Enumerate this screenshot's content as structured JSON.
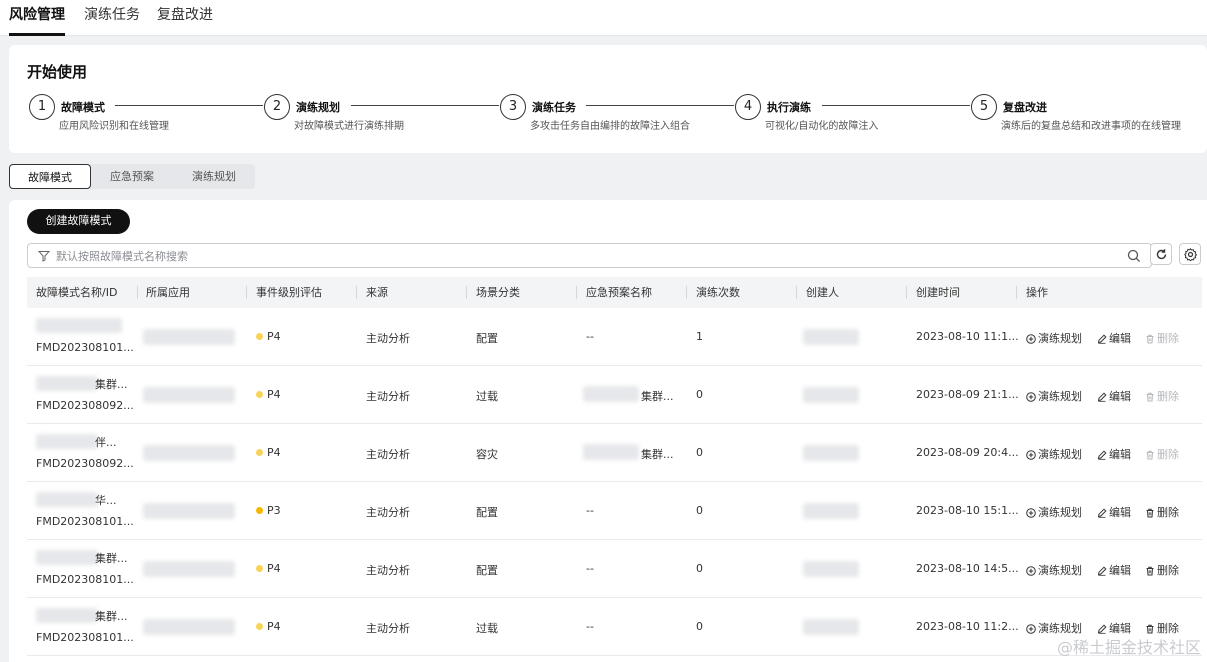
{
  "top_tabs": [
    "风险管理",
    "演练任务",
    "复盘改进"
  ],
  "start": {
    "title": "开始使用",
    "steps": [
      {
        "num": "1",
        "name": "故障模式",
        "desc": "应用风险识别和在线管理"
      },
      {
        "num": "2",
        "name": "演练规划",
        "desc": "对故障模式进行演练排期"
      },
      {
        "num": "3",
        "name": "演练任务",
        "desc": "多攻击任务自由编排的故障注入组合"
      },
      {
        "num": "4",
        "name": "执行演练",
        "desc": "可视化/自动化的故障注入"
      },
      {
        "num": "5",
        "name": "复盘改进",
        "desc": "演练后的复盘总结和改进事项的在线管理"
      }
    ]
  },
  "seg_tabs": [
    "故障模式",
    "应急预案",
    "演练规划"
  ],
  "create_button": "创建故障模式",
  "search": {
    "placeholder": "默认按照故障模式名称搜索"
  },
  "table": {
    "columns": [
      "故障模式名称/ID",
      "所属应用",
      "事件级别评估",
      "来源",
      "场景分类",
      "应急预案名称",
      "演练次数",
      "创建人",
      "创建时间",
      "操作"
    ],
    "rows": [
      {
        "name_suffix": "",
        "id": "FMD202308101...",
        "level": "P4",
        "source": "主动分析",
        "scene": "配置",
        "plan": "--",
        "plan_suffix": "",
        "count": "1",
        "time": "2023-08-10 11:1...",
        "delete_enabled": false
      },
      {
        "name_suffix": "集群...",
        "id": "FMD202308092...",
        "level": "P4",
        "source": "主动分析",
        "scene": "过载",
        "plan": "",
        "plan_suffix": "集群...",
        "count": "0",
        "time": "2023-08-09 21:1...",
        "delete_enabled": false
      },
      {
        "name_suffix": "伴...",
        "id": "FMD202308092...",
        "level": "P4",
        "source": "主动分析",
        "scene": "容灾",
        "plan": "",
        "plan_suffix": "集群...",
        "count": "0",
        "time": "2023-08-09 20:4...",
        "delete_enabled": false
      },
      {
        "name_suffix": "华...",
        "id": "FMD202308101...",
        "level": "P3",
        "source": "主动分析",
        "scene": "配置",
        "plan": "--",
        "plan_suffix": "",
        "count": "0",
        "time": "2023-08-10 15:1...",
        "delete_enabled": true
      },
      {
        "name_suffix": "集群...",
        "id": "FMD202308101...",
        "level": "P4",
        "source": "主动分析",
        "scene": "配置",
        "plan": "--",
        "plan_suffix": "",
        "count": "0",
        "time": "2023-08-10 14:5...",
        "delete_enabled": true
      },
      {
        "name_suffix": "集群...",
        "id": "FMD202308101...",
        "level": "P4",
        "source": "主动分析",
        "scene": "过载",
        "plan": "--",
        "plan_suffix": "",
        "count": "0",
        "time": "2023-08-10 11:2...",
        "delete_enabled": true
      }
    ],
    "actions": {
      "plan": "演练规划",
      "edit": "编辑",
      "delete": "删除"
    }
  },
  "level_colors": {
    "P4": "#f7d358",
    "P3": "#f5b800"
  },
  "watermark": "@稀土掘金技术社区"
}
